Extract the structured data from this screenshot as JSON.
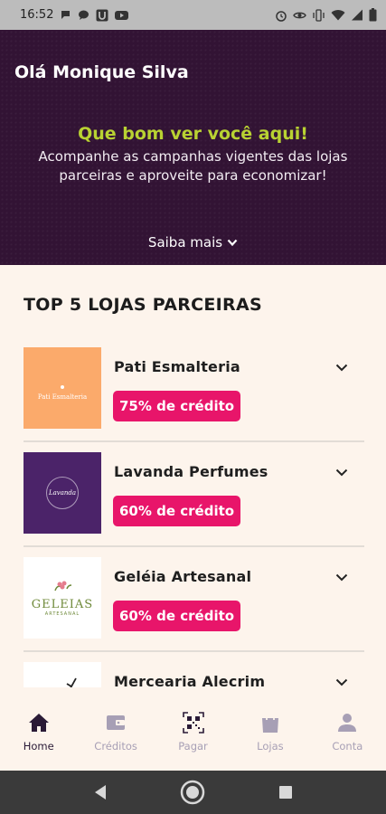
{
  "status_bar": {
    "time": "16:52",
    "left_icons": [
      "chat-bubble-icon",
      "message-icon",
      "u-app-icon",
      "youtube-icon"
    ],
    "right_icons": [
      "alarm-icon",
      "eye-icon",
      "vibrate-icon",
      "wifi-icon",
      "signal-icon",
      "battery-icon"
    ]
  },
  "hero": {
    "greeting": "Olá Monique Silva",
    "headline": "Que bom ver você aqui!",
    "subtitle": "Acompanhe as campanhas vigentes das lojas parceiras e aproveite para economizar!",
    "more_label": "Saiba mais"
  },
  "section": {
    "title": "TOP 5 LOJAS PARCEIRAS"
  },
  "stores": [
    {
      "name": "Pati Esmalteria",
      "badge": "75% de crédito",
      "logo_text": "Pati Esmalteria",
      "thumb_color": "#fbaa6b"
    },
    {
      "name": "Lavanda Perfumes",
      "badge": "60% de crédito",
      "logo_text": "Lavanda",
      "thumb_color": "#4b2369"
    },
    {
      "name": "Geléia Artesanal",
      "badge": "60% de crédito",
      "logo_text": "GELEIAS",
      "logo_sub": "ARTESANAL",
      "thumb_color": "#ffffff"
    },
    {
      "name": "Mercearia Alecrim",
      "badge": "",
      "logo_text": "",
      "thumb_color": "#ffffff"
    }
  ],
  "bottom_nav": [
    {
      "label": "Home",
      "icon": "home-icon",
      "active": true
    },
    {
      "label": "Créditos",
      "icon": "wallet-icon",
      "active": false
    },
    {
      "label": "Pagar",
      "icon": "qr-code-icon",
      "active": false
    },
    {
      "label": "Lojas",
      "icon": "shopping-bag-icon",
      "active": false
    },
    {
      "label": "Conta",
      "icon": "user-icon",
      "active": false
    }
  ],
  "colors": {
    "hero_bg": "#321334",
    "headline_green": "#b9d232",
    "badge_pink": "#e8156a",
    "nav_inactive": "#a79fb5",
    "nav_active": "#2a1a36",
    "page_bg": "#fdf4ec"
  }
}
